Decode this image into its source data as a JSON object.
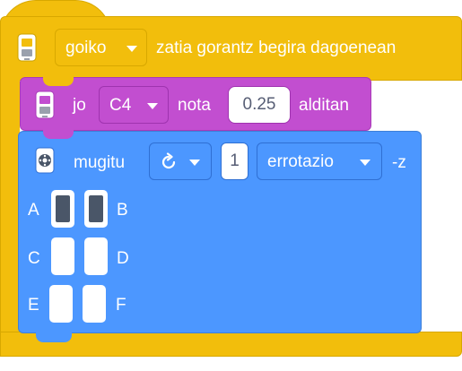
{
  "colors": {
    "event": "#f2be0c",
    "sound": "#c24ed0",
    "motion": "#4c97ff",
    "face_on": "#4a5668"
  },
  "hat": {
    "icon": "cube-controller-icon",
    "side_dropdown": "goiko",
    "label": "zatia gorantz begira dagoenean"
  },
  "note": {
    "icon": "speaker-device-icon",
    "label_play": "jo",
    "note_dropdown": "C4",
    "label_note": "nota",
    "duration_value": "0.25",
    "label_times": "alditan"
  },
  "move": {
    "icon": "motor-icon",
    "label_move": "mugitu",
    "direction_icon": "rotate-clockwise-icon",
    "amount_value": "1",
    "unit_dropdown": "errotazio",
    "axis_label": "-z",
    "faces": [
      {
        "label": "A",
        "active": true
      },
      {
        "label": "B",
        "active": true
      },
      {
        "label": "C",
        "active": false
      },
      {
        "label": "D",
        "active": false
      },
      {
        "label": "E",
        "active": false
      },
      {
        "label": "F",
        "active": false
      }
    ]
  }
}
